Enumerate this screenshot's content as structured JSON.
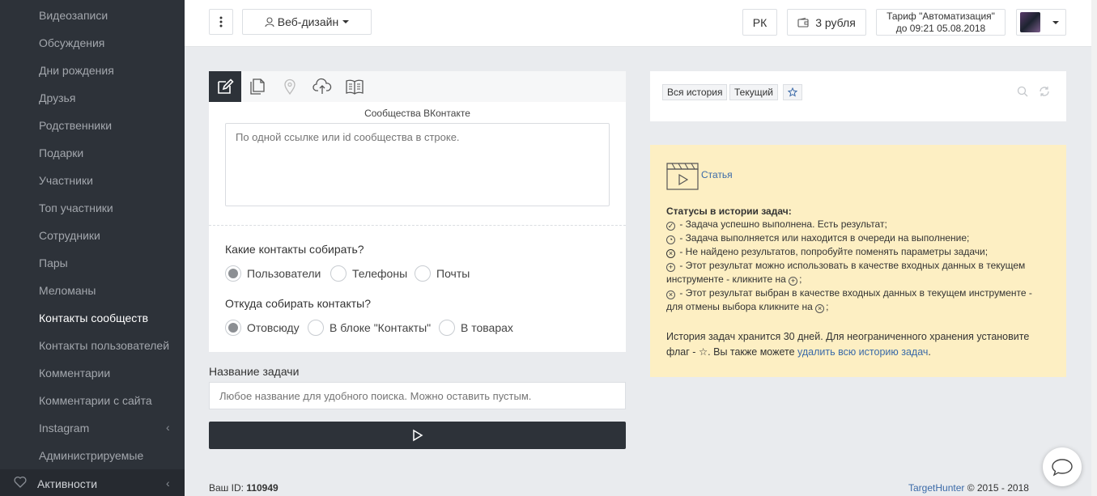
{
  "sidebar": {
    "items": [
      {
        "label": "Видеозаписи"
      },
      {
        "label": "Обсуждения"
      },
      {
        "label": "Дни рождения"
      },
      {
        "label": "Друзья"
      },
      {
        "label": "Родственники"
      },
      {
        "label": "Подарки"
      },
      {
        "label": "Участники"
      },
      {
        "label": "Топ участники"
      },
      {
        "label": "Сотрудники"
      },
      {
        "label": "Пары"
      },
      {
        "label": "Меломаны"
      },
      {
        "label": "Контакты сообществ",
        "active": true
      },
      {
        "label": "Контакты пользователей"
      },
      {
        "label": "Комментарии"
      },
      {
        "label": "Комментарии с сайта"
      },
      {
        "label": "Instagram",
        "has_submenu": true
      },
      {
        "label": "Администрируемые"
      }
    ],
    "bottom_label": "Активности"
  },
  "topbar": {
    "project": "Веб-дизайн",
    "rk": "РК",
    "balance": "3 рубля",
    "tariff_line1": "Тариф \"Автоматизация\"",
    "tariff_line2": "до 09:21 05.08.2018"
  },
  "form": {
    "tabs": [
      "edit-icon",
      "files-icon",
      "location-icon",
      "cloud-upload-icon",
      "book-icon"
    ],
    "section_label": "Сообщества ВКонтакте",
    "textarea_placeholder": "По одной ссылке или id сообщества в строке.",
    "q1": "Какие контакты собирать?",
    "q1_options": [
      "Пользователи",
      "Телефоны",
      "Почты"
    ],
    "q2": "Откуда собирать контакты?",
    "q2_options": [
      "Отовсюду",
      "В блоке \"Контакты\"",
      "В товарах"
    ],
    "task_label": "Название задачи",
    "task_placeholder": "Любое название для удобного поиска. Можно оставить пустым."
  },
  "history": {
    "all": "Вся история",
    "current": "Текущий"
  },
  "info": {
    "article": "Статья",
    "statuses_title": "Статусы в истории задач:",
    "s1": " - Задача успешно выполнена. Есть результат;",
    "s2": " - Задача выполняется или находится в очереди на выполнение;",
    "s3": " - Не найдено результатов, попробуйте поменять параметры задачи;",
    "s4a": " - Этот результат можно использовать в качестве входных данных в текущем",
    "s4b": "инструменте - кликните на",
    "s5a": " - Этот результат выбран в качестве входных данных в текущем инструменте -",
    "s5b": "для отмены выбора кликните на",
    "storage_a": "История задач хранится 30 дней. Для неограниченного хранения установите",
    "storage_b1": "флаг - ",
    "storage_b2": ". Вы также можете ",
    "storage_link": "удалить всю историю задач",
    "storage_end": "."
  },
  "footer": {
    "id_label": "Ваш ID: ",
    "id_value": "110949",
    "brand": "TargetHunter",
    "copyright": " © 2015 - 2018"
  }
}
